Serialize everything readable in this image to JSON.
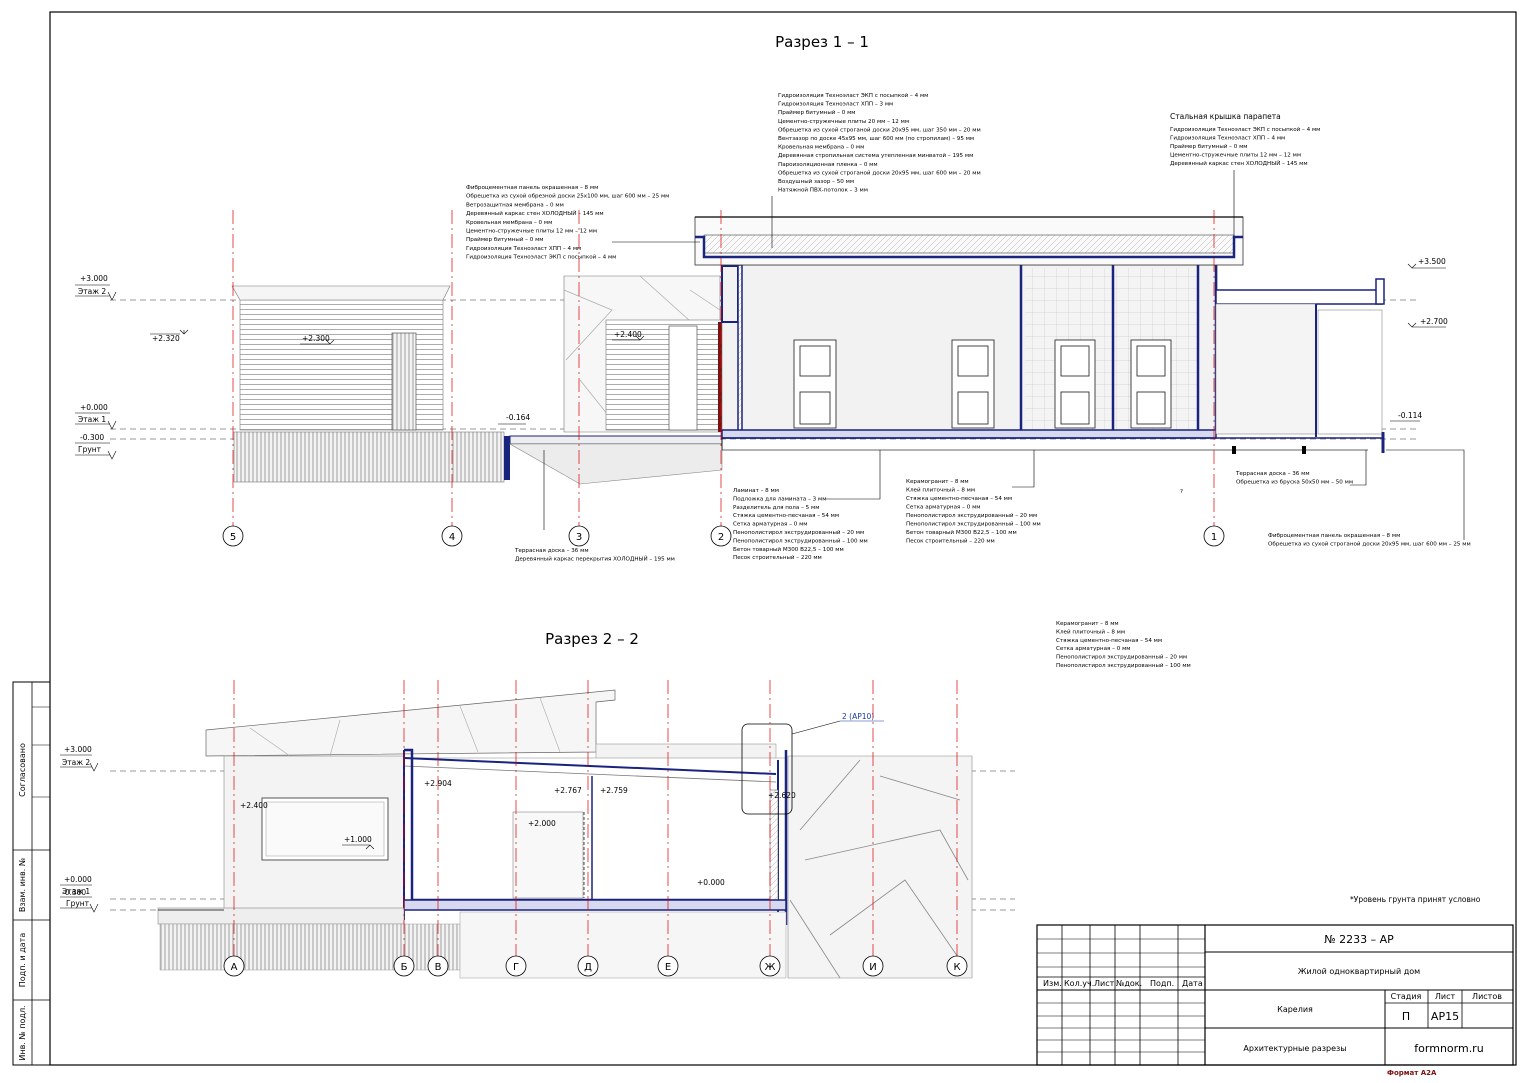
{
  "sections": [
    {
      "title": "Разрез 1 – 1"
    },
    {
      "title": "Разрез 2 – 2"
    }
  ],
  "section1": {
    "levels": [
      {
        "value": "+3.000",
        "label": "Этаж 2"
      },
      {
        "value": "+0.000",
        "label": "Этаж 1"
      },
      {
        "value": "-0.300",
        "label": "Грунт"
      }
    ],
    "marks": [
      "+2.320",
      "+2.300",
      "+2.400",
      "-0.164",
      "+3.500",
      "+2.700",
      "-0.114"
    ],
    "axes": [
      "5",
      "4",
      "3",
      "2",
      "1"
    ],
    "notes": {
      "roof_top": [
        "Гидроизоляция Техноэласт ЭКП с посыпкой – 4 мм",
        "Гидроизоляция Техноэласт ХПП – 3 мм",
        "Праймер битумный – 0 мм",
        "Цементно-стружечные плиты 20 мм – 12 мм",
        "Обрешетка из сухой строганой доски 20х95 мм, шаг 350 мм – 20 мм",
        "Вентзазор по доске 45х95 мм, шаг 600 мм (по стропилам) – 95 мм",
        "Кровельная мембрана – 0 мм",
        "Деревянная стропильная система утепленная минватой – 195 мм",
        "Пароизоляционная пленка – 0 мм",
        "Обрешетка из сухой строганой доски 20х95 мм, шаг 600 мм – 20 мм",
        "Воздушный зазор – 50 мм",
        "Натяжной ПВХ-потолок – 3 мм"
      ],
      "wall_left": [
        "Фиброцементная панель окрашенная – 8 мм",
        "Обрешетка из сухой обрезной доски 25х100 мм, шаг 600 мм – 25 мм",
        "Ветрозащитная мембрана – 0 мм",
        "Деревянный каркас стен ХОЛОДНЫЙ – 145 мм",
        "Кровельная мембрана – 0 мм",
        "Цементно-стружечные плиты 12 мм – 12 мм",
        "Праймер битумный – 0 мм",
        "Гидроизоляция Техноэласт ХПП – 4 мм",
        "Гидроизоляция Техноэласт ЭКП с посыпкой – 4 мм"
      ],
      "parapet_title": "Стальная крышка парапета",
      "parapet": [
        "Гидроизоляция Техноэласт ЭКП с посыпкой – 4 мм",
        "Гидроизоляция Техноэласт ХПП – 4 мм",
        "Праймер битумный – 0 мм",
        "Цементно-стружечные плиты 12 мм – 12 мм",
        "Деревянный каркас стен ХОЛОДНЫЙ – 145 мм"
      ],
      "floor_1": [
        "Ламинат – 8 мм",
        "Подложка для ламината – 3 мм",
        "Разделитель для пола – 5 мм",
        "Стяжка цементно-песчаная – 54 мм",
        "Сетка арматурная – 0 мм",
        "Пенополистирол экструдированный – 20 мм",
        "Пенополистирол экструдированный – 100 мм",
        "Бетон товарный М300 В22,5 – 100 мм",
        "Песок строительный – 220 мм"
      ],
      "floor_2": [
        "Керамогранит – 8 мм",
        "Клей плиточный – 8 мм",
        "Стяжка цементно-песчаная – 54 мм",
        "Сетка арматурная – 0 мм",
        "Пенополистирол экструдированный – 20 мм",
        "Пенополистирол экструдированный – 100 мм",
        "Бетон товарный М300 В22,5 – 100 мм",
        "Песок строительный – 220 мм"
      ],
      "terrace_left": [
        "Террасная доска – 36 мм",
        "Деревянный каркас перекрытия ХОЛОДНЫЙ – 195 мм"
      ],
      "terrace_right": [
        "Террасная доска – 36 мм",
        "Обрешетка из бруска 50х50 мм – 50 мм"
      ],
      "facade_right": [
        "Фиброцементная панель окрашенная – 8 мм",
        "Обрешетка из сухой строганой доски 20х95 мм, шаг 600 мм – 25 мм"
      ],
      "floor_3": [
        "Керамогранит – 8 мм",
        "Клей плиточный – 8 мм",
        "Стяжка цементно-песчаная – 54 мм",
        "Сетка арматурная – 0 мм",
        "Пенополистирол экструдированный – 20 мм",
        "Пенополистирол экструдированный – 100 мм"
      ]
    },
    "question": "?"
  },
  "section2": {
    "levels": [
      {
        "value": "+3.000",
        "label": "Этаж 2"
      },
      {
        "value": "+0.000",
        "label": "Этаж 1"
      },
      {
        "value": "-0.300",
        "label": "Грунт"
      }
    ],
    "marks": [
      "+2.400",
      "+1.000",
      "+2.904",
      "+2.767",
      "+2.759",
      "+2.000",
      "+2.620",
      "+0.000"
    ],
    "axes": [
      "А",
      "Б",
      "В",
      "Г",
      "Д",
      "Е",
      "Ж",
      "И",
      "К"
    ],
    "callout": "2 (АР10)",
    "footnote": "*Уровень грунта принят условно"
  },
  "side_stamps": [
    "Согласовано",
    "Взам. инв. №",
    "Подп. и дата",
    "Инв. № подл."
  ],
  "title_block": {
    "doc_no": "№ 2233 – АР",
    "project": "Жилой одноквартирный дом",
    "location": "Карелия",
    "sheet_title": "Архитектурные разрезы",
    "headers": [
      "Изм.",
      "Кол.уч.",
      "Лист",
      "№док.",
      "Подп.",
      "Дата"
    ],
    "stage_header": "Стадия",
    "sheet_header": "Лист",
    "sheets_header": "Листов",
    "stage": "П",
    "sheet": "АР15",
    "sheets": "",
    "brand": "formnorm.ru",
    "format": "Формат А2А"
  }
}
